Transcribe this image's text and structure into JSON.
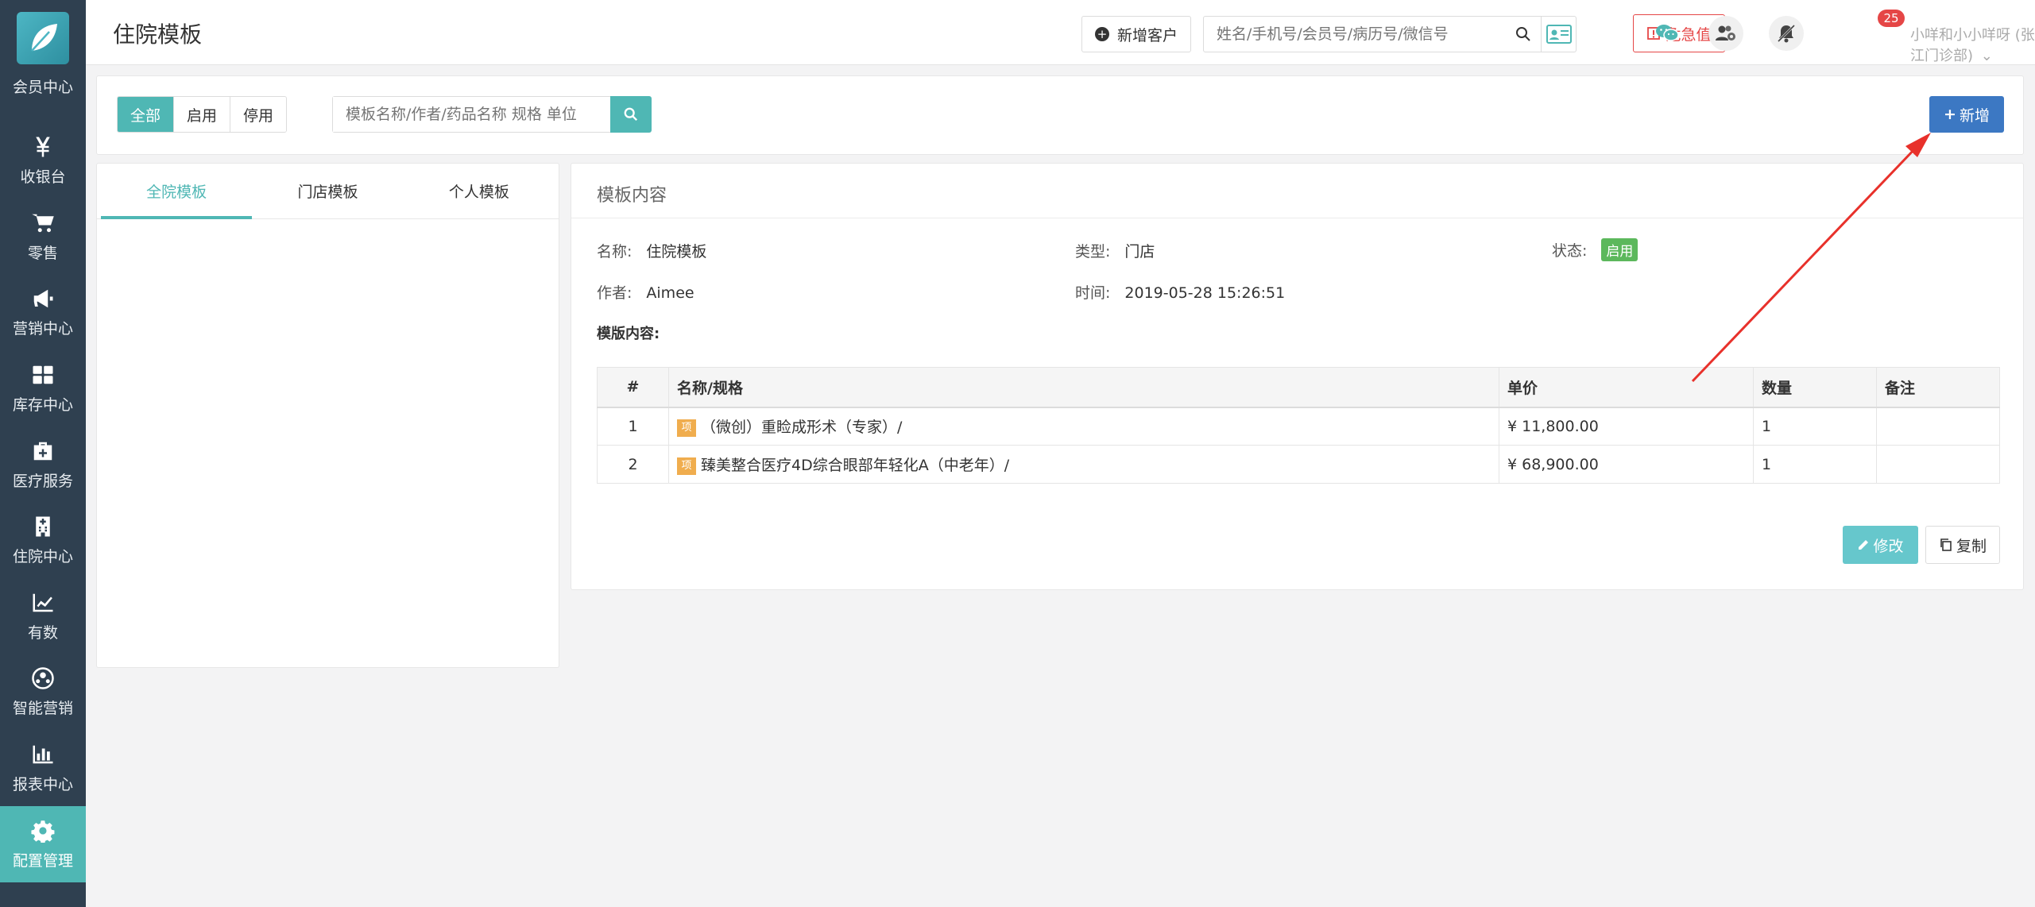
{
  "sidebar": {
    "items": [
      {
        "label": "会员中心",
        "icon": "member-icon"
      },
      {
        "label": "收银台",
        "icon": "yen-icon"
      },
      {
        "label": "零售",
        "icon": "cart-icon"
      },
      {
        "label": "营销中心",
        "icon": "megaphone-icon"
      },
      {
        "label": "库存中心",
        "icon": "grid-icon"
      },
      {
        "label": "医疗服务",
        "icon": "medkit-icon"
      },
      {
        "label": "住院中心",
        "icon": "hospital-icon"
      },
      {
        "label": "有数",
        "icon": "line-chart-icon"
      },
      {
        "label": "智能营销",
        "icon": "network-icon"
      },
      {
        "label": "报表中心",
        "icon": "bar-chart-icon"
      },
      {
        "label": "配置管理",
        "icon": "gear-icon"
      }
    ],
    "active_index": 10
  },
  "header": {
    "title": "住院模板",
    "new_customer_label": "新增客户",
    "search_placeholder": "姓名/手机号/会员号/病历号/微信号",
    "danger_label": "危急值",
    "badge_count": "25",
    "user": "小咩和小小咩呀 (张江门诊部)"
  },
  "filter": {
    "segments": [
      "全部",
      "启用",
      "停用"
    ],
    "active_segment": 0,
    "search_placeholder": "模板名称/作者/药品名称 规格 单位",
    "add_label": "新增"
  },
  "tabs": [
    "全院模板",
    "门店模板",
    "个人模板"
  ],
  "active_tab": 0,
  "detail": {
    "title": "模板内容",
    "name_label": "名称:",
    "name": "住院模板",
    "type_label": "类型:",
    "type": "门店",
    "status_label": "状态:",
    "status": "启用",
    "author_label": "作者:",
    "author": "Aimee",
    "time_label": "时间:",
    "time": "2019-05-28 15:26:51",
    "content_label": "模版内容:",
    "table": {
      "headers": [
        "#",
        "名称/规格",
        "单价",
        "数量",
        "备注"
      ],
      "tag": "项",
      "rows": [
        {
          "idx": "1",
          "name": "（微创）重睑成形术（专家）/",
          "price": "¥ 11,800.00",
          "qty": "1",
          "note": ""
        },
        {
          "idx": "2",
          "name": "臻美整合医疗4D综合眼部年轻化A（中老年）/",
          "price": "¥ 68,900.00",
          "qty": "1",
          "note": ""
        }
      ]
    },
    "edit_label": "修改",
    "copy_label": "复制"
  },
  "colors": {
    "sidebar_bg": "#2f4050",
    "accent": "#4fb7b4",
    "primary": "#3c78c3",
    "danger": "#e54646",
    "success": "#5cb85c",
    "annotation_arrow": "#e8312b"
  }
}
